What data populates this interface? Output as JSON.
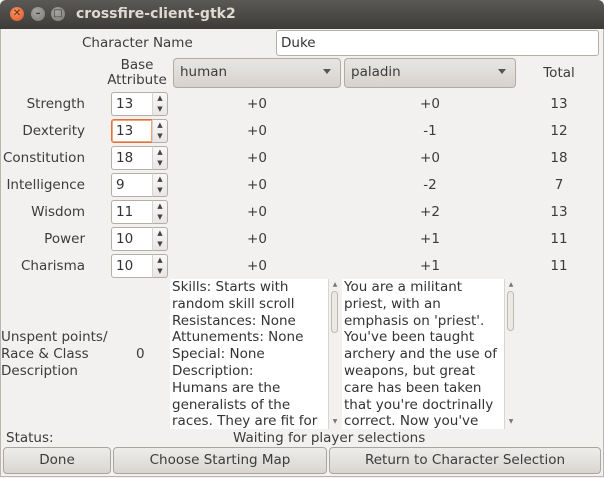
{
  "window": {
    "title": "crossfire-client-gtk2"
  },
  "name": {
    "label": "Character Name",
    "value": "Duke"
  },
  "columns": {
    "base_attribute": "Base\nAttribute",
    "race": "human",
    "class": "paladin",
    "total": "Total"
  },
  "stats": [
    {
      "name": "Strength",
      "base": "13",
      "race": "+0",
      "class": "+0",
      "total": "13"
    },
    {
      "name": "Dexterity",
      "base": "13",
      "race": "+0",
      "class": "-1",
      "total": "12"
    },
    {
      "name": "Constitution",
      "base": "18",
      "race": "+0",
      "class": "+0",
      "total": "18"
    },
    {
      "name": "Intelligence",
      "base": "9",
      "race": "+0",
      "class": "-2",
      "total": "7"
    },
    {
      "name": "Wisdom",
      "base": "11",
      "race": "+0",
      "class": "+2",
      "total": "13"
    },
    {
      "name": "Power",
      "base": "10",
      "race": "+0",
      "class": "+1",
      "total": "11"
    },
    {
      "name": "Charisma",
      "base": "10",
      "race": "+0",
      "class": "+1",
      "total": "11"
    }
  ],
  "unspent": {
    "label_line1": "Unspent points/",
    "label_line2": "Race & Class",
    "label_line3": "Description",
    "value": "0"
  },
  "race_description": [
    "Skills: Starts with",
    "random skill scroll",
    "Resistances: None",
    "Attunements: None",
    "Special: None",
    "Description:",
    "Humans are the",
    "generalists of the",
    "races. They are fit for"
  ],
  "class_description": [
    "You are a militant",
    "priest, with an",
    "emphasis on 'priest'.",
    "You've been taught",
    "archery and the use of",
    "weapons, but great",
    "care has been taken",
    "that you're doctrinally",
    "correct.  Now you've"
  ],
  "status": {
    "label": "Status:",
    "message": "Waiting for player selections"
  },
  "buttons": {
    "done": "Done",
    "choose_map": "Choose Starting Map",
    "return": "Return to Character Selection"
  }
}
